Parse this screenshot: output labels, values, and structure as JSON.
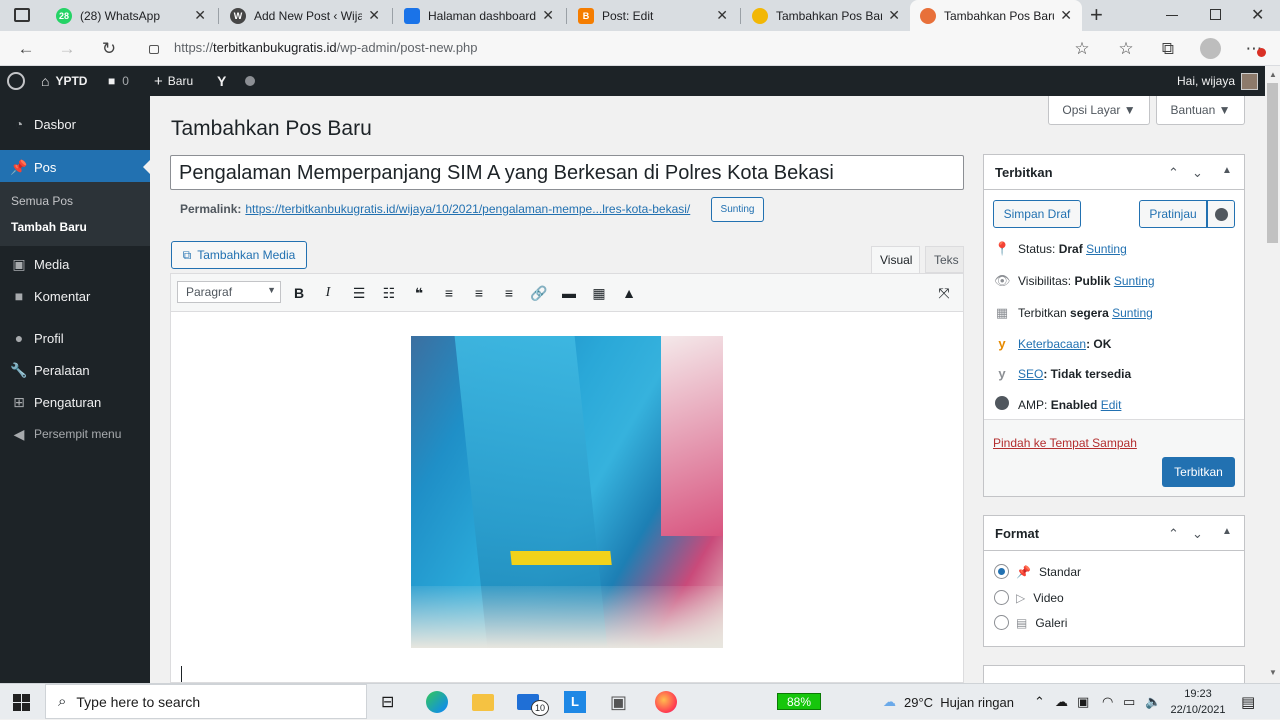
{
  "browser": {
    "tabs": [
      {
        "title": "(28) WhatsApp",
        "badge": "28"
      },
      {
        "title": "Add New Post ‹ Wijaya"
      },
      {
        "title": "Halaman dashboard m"
      },
      {
        "title": "Post: Edit"
      },
      {
        "title": "Tambahkan Pos Baru ‹"
      },
      {
        "title": "Tambahkan Pos Baru ‹"
      }
    ],
    "new_tab_label": "+",
    "url_prefix": "https://",
    "url_host": "terbitkanbukugratis.id",
    "url_path": "/wp-admin/post-new.php"
  },
  "adminbar": {
    "site_name": "YPTD",
    "comments_count": "0",
    "new_label": "Baru",
    "greeting": "Hai, wijaya"
  },
  "sidebar": {
    "items": [
      {
        "label": "Dasbor",
        "icon": "dashboard-icon"
      },
      {
        "label": "Pos",
        "icon": "pin-icon"
      },
      {
        "label": "Media",
        "icon": "media-icon"
      },
      {
        "label": "Komentar",
        "icon": "comment-icon"
      },
      {
        "label": "Profil",
        "icon": "user-icon"
      },
      {
        "label": "Peralatan",
        "icon": "wrench-icon"
      },
      {
        "label": "Pengaturan",
        "icon": "settings-icon"
      },
      {
        "label": "Persempit menu",
        "icon": "collapse-icon"
      }
    ],
    "submenu": [
      "Semua Pos",
      "Tambah Baru"
    ]
  },
  "page": {
    "screen_options": "Opsi Layar ▼",
    "help": "Bantuan ▼",
    "heading": "Tambahkan Pos Baru",
    "post_title": "Pengalaman Memperpanjang SIM A yang Berkesan di Polres Kota Bekasi",
    "permalink_label": "Permalink:",
    "permalink_url": "https://terbitkanbukugratis.id/wijaya/10/2021/pengalaman-mempe...lres-kota-bekasi/",
    "permalink_edit": "Sunting",
    "add_media": "Tambahkan Media",
    "tab_visual": "Visual",
    "tab_text": "Teks",
    "format_select": "Paragraf"
  },
  "publish": {
    "title": "Terbitkan",
    "save_draft": "Simpan Draf",
    "preview": "Pratinjau",
    "status_label": "Status:",
    "status_value": "Draf",
    "visibility_label": "Visibilitas:",
    "visibility_value": "Publik",
    "schedule_label": "Terbitkan",
    "schedule_value": "segera",
    "edit_link": "Sunting",
    "readability_link": "Keterbacaan",
    "readability_value": ": OK",
    "seo_link": "SEO",
    "seo_value": ": Tidak tersedia",
    "amp_label": "AMP:",
    "amp_value": "Enabled",
    "amp_edit": "Edit",
    "trash": "Pindah ke Tempat Sampah",
    "publish_button": "Terbitkan"
  },
  "format_box": {
    "title": "Format",
    "options": [
      {
        "label": "Standar",
        "checked": true
      },
      {
        "label": "Video",
        "checked": false
      },
      {
        "label": "Galeri",
        "checked": false
      }
    ]
  },
  "taskbar": {
    "search_placeholder": "Type here to search",
    "battery": "88%",
    "weather": "29°C  Hujan ringan",
    "time": "19:23",
    "date": "22/10/2021",
    "mail_badge": "10"
  },
  "colors": {
    "wp_dark": "#1d2327",
    "wp_blue": "#2271b1",
    "trash_red": "#b32d2e"
  }
}
